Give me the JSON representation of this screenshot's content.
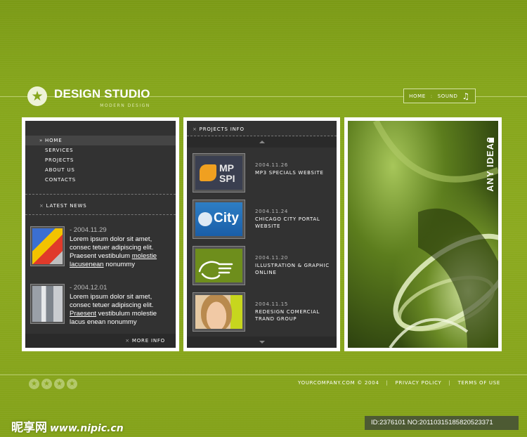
{
  "brand": {
    "title": "DESIGN STUDIO",
    "subtitle": "MODERN DESIGN",
    "logo_icon": "star-icon"
  },
  "topnav": {
    "home": "HOME",
    "separator": ":",
    "sound": "SOUND",
    "sound_icon": "music-note-icon"
  },
  "menu": {
    "items": [
      {
        "label": "HOME",
        "active": true
      },
      {
        "label": "SERVICES"
      },
      {
        "label": "PROJECTS"
      },
      {
        "label": "ABOUT US"
      },
      {
        "label": "CONTACTS"
      }
    ]
  },
  "news": {
    "title": "LATEST NEWS",
    "items": [
      {
        "date": "- 2004.11.29",
        "text_a": "Lorem ipsum dolor sit amet, consec tetuer adipiscing elit. Praesent vestibulum ",
        "link_a": "molestie lacusenean",
        "text_b": " nonummy"
      },
      {
        "date": "- 2004.12.01",
        "text_a": "Lorem ipsum dolor sit amet, consec tetuer adipiscing elit. ",
        "link_a": "Praesent",
        "text_b": " vestibulum molestie lacus enean nonummy"
      }
    ],
    "more": "MORE INFO"
  },
  "projects": {
    "title": "PROJECTS INFO",
    "items": [
      {
        "date": "2004.11.26",
        "title": "MP3 SPECIALS WEBSITE",
        "thumb_text": "MP SPI"
      },
      {
        "date": "2004.11.24",
        "title": "CHICAGO CITY PORTAL WEBSITE",
        "thumb_text": "City"
      },
      {
        "date": "2004.11.20",
        "title": "ILLUSTRATION & GRAPHIC ONLINE"
      },
      {
        "date": "2004.11.15",
        "title": "REDESIGN COMERCIAL TRAND GROUP"
      }
    ]
  },
  "hero": {
    "tagline": "ANY IDEA?"
  },
  "footer": {
    "copyright": "YOURCOMPANY.COM © 2004",
    "privacy": "PRIVACY POLICY",
    "terms": "TERMS OF USE",
    "separator": "|"
  },
  "watermark": {
    "site": "昵享网",
    "url": "www.nipic.cn",
    "id": "ID:2376101 NO:20110315185820523371"
  },
  "colors": {
    "background": "#86a61c",
    "panel": "#323232",
    "panel_border": "#ffffff"
  }
}
